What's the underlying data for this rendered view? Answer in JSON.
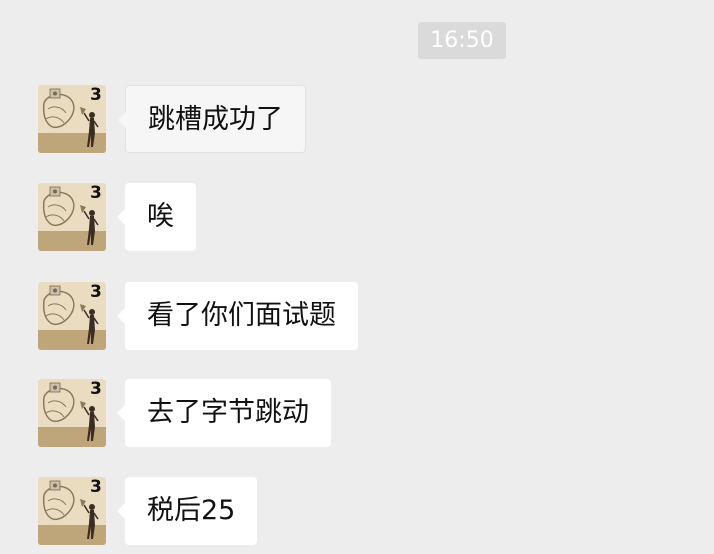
{
  "chat": {
    "timestamp": "16:50",
    "avatar_badge": "3",
    "messages": [
      {
        "text": "跳槽成功了",
        "style": "grey"
      },
      {
        "text": "唉",
        "style": "white"
      },
      {
        "text": "看了你们面试题",
        "style": "white"
      },
      {
        "text": "去了字节跳动",
        "style": "white"
      },
      {
        "text": "税后25",
        "style": "white"
      }
    ]
  }
}
